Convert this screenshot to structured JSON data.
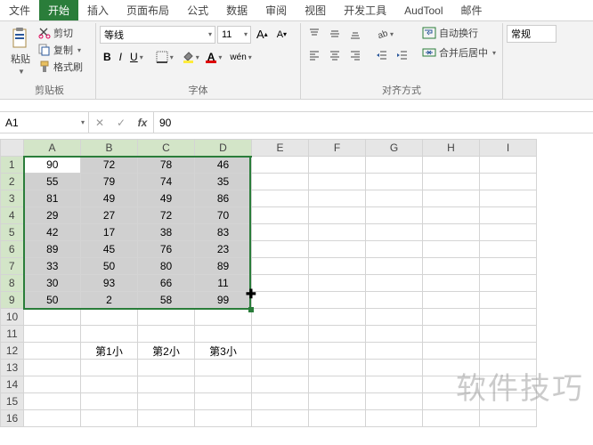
{
  "tabs": [
    "文件",
    "开始",
    "插入",
    "页面布局",
    "公式",
    "数据",
    "审阅",
    "视图",
    "开发工具",
    "AudTool",
    "邮件"
  ],
  "active_tab": 1,
  "clipboard": {
    "paste": "粘贴",
    "cut": "剪切",
    "copy": "复制",
    "format_painter": "格式刷",
    "label": "剪贴板"
  },
  "font": {
    "name": "等线",
    "size": "11",
    "wen": "wén",
    "label": "字体"
  },
  "alignment": {
    "wrap": "自动换行",
    "merge": "合并后居中",
    "label": "对齐方式"
  },
  "number": {
    "format": "常规"
  },
  "name_box": "A1",
  "formula": "90",
  "columns": [
    "A",
    "B",
    "C",
    "D",
    "E",
    "F",
    "G",
    "H",
    "I"
  ],
  "sel_cols": 4,
  "sel_rows": 9,
  "row_count": 16,
  "active_cell": {
    "r": 0,
    "c": 0
  },
  "data": [
    [
      "90",
      "72",
      "78",
      "46",
      "",
      "",
      "",
      "",
      ""
    ],
    [
      "55",
      "79",
      "74",
      "35",
      "",
      "",
      "",
      "",
      ""
    ],
    [
      "81",
      "49",
      "49",
      "86",
      "",
      "",
      "",
      "",
      ""
    ],
    [
      "29",
      "27",
      "72",
      "70",
      "",
      "",
      "",
      "",
      ""
    ],
    [
      "42",
      "17",
      "38",
      "83",
      "",
      "",
      "",
      "",
      ""
    ],
    [
      "89",
      "45",
      "76",
      "23",
      "",
      "",
      "",
      "",
      ""
    ],
    [
      "33",
      "50",
      "80",
      "89",
      "",
      "",
      "",
      "",
      ""
    ],
    [
      "30",
      "93",
      "66",
      "11",
      "",
      "",
      "",
      "",
      ""
    ],
    [
      "50",
      "2",
      "58",
      "99",
      "",
      "",
      "",
      "",
      ""
    ],
    [
      "",
      "",
      "",
      "",
      "",
      "",
      "",
      "",
      ""
    ],
    [
      "",
      "",
      "",
      "",
      "",
      "",
      "",
      "",
      ""
    ],
    [
      "",
      "第1小",
      "第2小",
      "第3小",
      "",
      "",
      "",
      "",
      ""
    ],
    [
      "",
      "",
      "",
      "",
      "",
      "",
      "",
      "",
      ""
    ],
    [
      "",
      "",
      "",
      "",
      "",
      "",
      "",
      "",
      ""
    ],
    [
      "",
      "",
      "",
      "",
      "",
      "",
      "",
      "",
      ""
    ],
    [
      "",
      "",
      "",
      "",
      "",
      "",
      "",
      "",
      ""
    ]
  ],
  "watermark": "软件技巧",
  "chart_data": {
    "type": "table",
    "title": "",
    "columns": [
      "A",
      "B",
      "C",
      "D"
    ],
    "rows": [
      [
        90,
        72,
        78,
        46
      ],
      [
        55,
        79,
        74,
        35
      ],
      [
        81,
        49,
        49,
        86
      ],
      [
        29,
        27,
        72,
        70
      ],
      [
        42,
        17,
        38,
        83
      ],
      [
        89,
        45,
        76,
        23
      ],
      [
        33,
        50,
        80,
        89
      ],
      [
        30,
        93,
        66,
        11
      ],
      [
        50,
        2,
        58,
        99
      ]
    ],
    "labels_row12": [
      "",
      "第1小",
      "第2小",
      "第3小"
    ]
  }
}
